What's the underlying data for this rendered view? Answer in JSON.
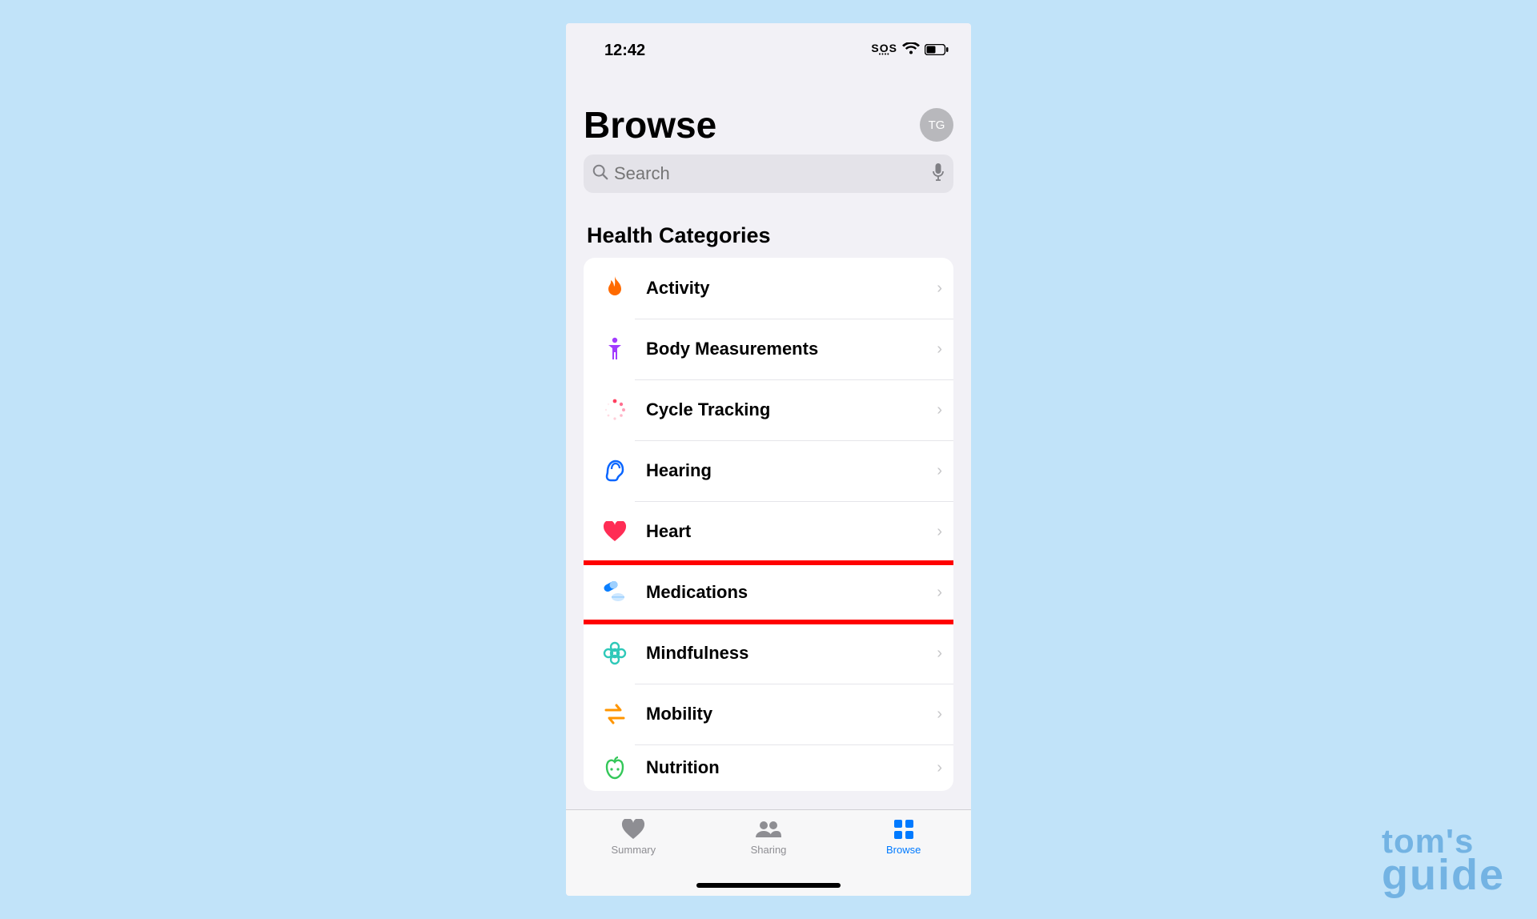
{
  "status": {
    "time": "12:42",
    "sos": "SOS"
  },
  "header": {
    "title": "Browse",
    "avatar_initials": "TG"
  },
  "search": {
    "placeholder": "Search"
  },
  "section_title": "Health Categories",
  "categories": [
    {
      "label": "Activity",
      "icon": "flame"
    },
    {
      "label": "Body Measurements",
      "icon": "body"
    },
    {
      "label": "Cycle Tracking",
      "icon": "cycle"
    },
    {
      "label": "Hearing",
      "icon": "hearing"
    },
    {
      "label": "Heart",
      "icon": "heart"
    },
    {
      "label": "Medications",
      "icon": "medications",
      "highlighted": true
    },
    {
      "label": "Mindfulness",
      "icon": "mindfulness"
    },
    {
      "label": "Mobility",
      "icon": "mobility"
    },
    {
      "label": "Nutrition",
      "icon": "nutrition"
    }
  ],
  "tabs": [
    {
      "label": "Summary",
      "icon": "heart",
      "active": false
    },
    {
      "label": "Sharing",
      "icon": "people",
      "active": false
    },
    {
      "label": "Browse",
      "icon": "grid",
      "active": true
    }
  ],
  "watermark": {
    "line1": "tom's",
    "line2": "guide"
  }
}
